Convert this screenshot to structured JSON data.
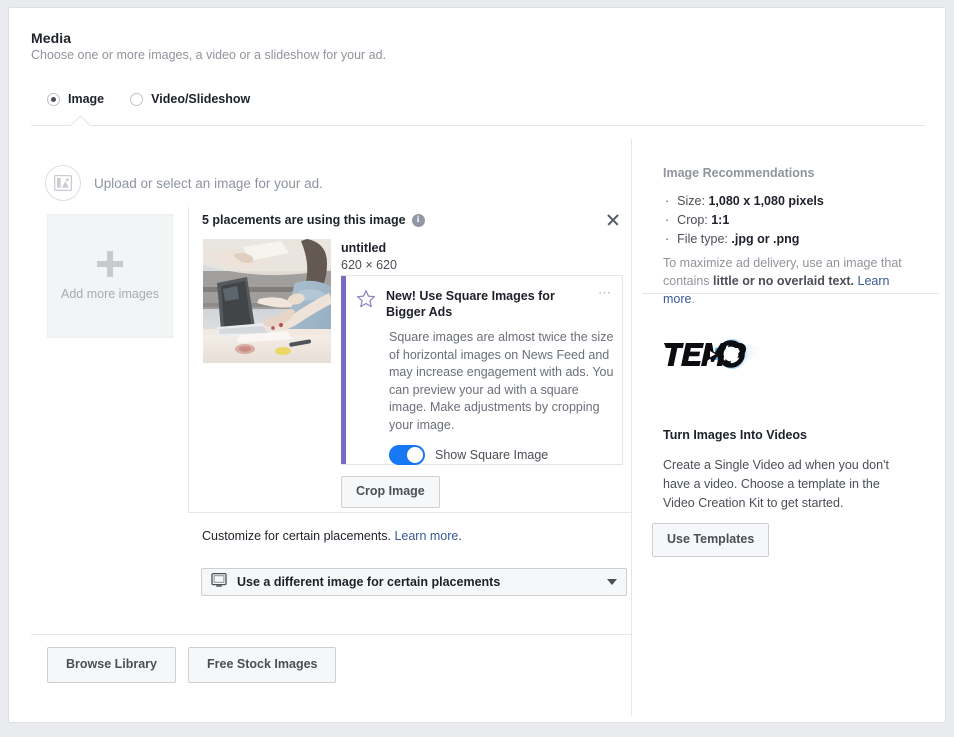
{
  "section": {
    "title": "Media",
    "subtitle": "Choose one or more images, a video or a slideshow for your ad."
  },
  "media_type": {
    "selected": "Image",
    "options": [
      {
        "label": "Image",
        "selected": true
      },
      {
        "label": "Video/Slideshow",
        "selected": false
      }
    ]
  },
  "upload": {
    "icon": "image-placeholder-icon",
    "text": "Upload or select an image for your ad."
  },
  "add_tile": {
    "icon": "plus-icon",
    "label": "Add more images"
  },
  "placements": {
    "header": "5 placements are using this image",
    "info_icon": "info-icon",
    "close_icon": "close-icon"
  },
  "file": {
    "name": "untitled",
    "dimensions": "620 × 620",
    "thumbnail_alt": "people-working-at-desk-photo"
  },
  "promo": {
    "accent_color": "#7d6ac4",
    "star_icon": "star-outline-icon",
    "overflow_icon": "ellipsis-icon",
    "title": "New! Use Square Images for Bigger Ads",
    "body": "Square images are almost twice the size of horizontal images on News Feed and may increase engagement with ads. You can preview your ad with a square image. Make adjustments by cropping your image.",
    "toggle": {
      "label": "Show Square Image",
      "on": true,
      "color": "#1878f3"
    }
  },
  "crop_button": {
    "label": "Crop Image"
  },
  "customize": {
    "text": "Customize for certain placements.",
    "link": "Learn more",
    "period": "."
  },
  "placement_select": {
    "icon": "monitor-icon",
    "label": "Use a different image for certain placements",
    "caret_icon": "chevron-down-icon"
  },
  "bottom_buttons": [
    {
      "label": "Browse Library"
    },
    {
      "label": "Free Stock Images"
    }
  ],
  "sidebar": {
    "recommendations_title": "Image Recommendations",
    "items": [
      {
        "label": "Size:",
        "value": "1,080 x 1,080 pixels"
      },
      {
        "label": "Crop:",
        "value": "1:1"
      },
      {
        "label": "File type:",
        "value": ".jpg or .png"
      }
    ],
    "note_pre": "To maximize ad delivery, use an image that contains ",
    "note_bold": "little or no overlaid text.",
    "note_link": "Learn more",
    "note_period": ".",
    "logo": {
      "text": "TEMPO",
      "icon": "tempo-logo",
      "accent_color": "#0b8ae8"
    },
    "promo_title": "Turn Images Into Videos",
    "promo_body": "Create a Single Video ad when you don't have a video. Choose a template in the Video Creation Kit to get started.",
    "promo_button": "Use Templates"
  }
}
